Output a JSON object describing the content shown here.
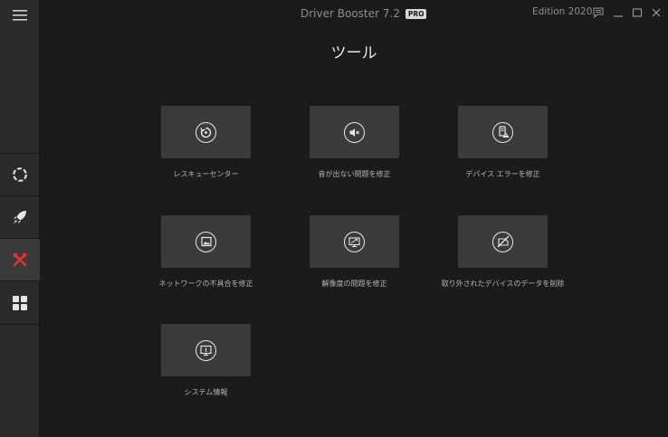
{
  "window": {
    "app_name": "Driver Booster 7.2",
    "badge": "PRO",
    "edition": "Edition 2020"
  },
  "page_title": "ツール",
  "tools": [
    {
      "label": "レスキューセンター",
      "icon": "rescue-restore-icon"
    },
    {
      "label": "音が出ない問題を修正",
      "icon": "speaker-mute-icon"
    },
    {
      "label": "デバイス エラーを修正",
      "icon": "device-error-icon"
    },
    {
      "label": "ネットワークの不具合を修正",
      "icon": "network-image-icon"
    },
    {
      "label": "解像度の問題を修正",
      "icon": "monitor-resolution-icon"
    },
    {
      "label": "取り外されたデバイスのデータを削除",
      "icon": "device-removed-icon"
    },
    {
      "label": "システム情報",
      "icon": "system-info-icon"
    }
  ],
  "sidebar": {
    "items": [
      {
        "icon": "scan-ring-icon"
      },
      {
        "icon": "rocket-icon"
      },
      {
        "icon": "tools-icon",
        "active": true
      },
      {
        "icon": "grid-icon"
      }
    ]
  },
  "colors": {
    "accent_active": "#e8322c",
    "background": "#1b1b1b",
    "sidebar": "#2b2b2b",
    "tile": "#3b3b3b"
  }
}
